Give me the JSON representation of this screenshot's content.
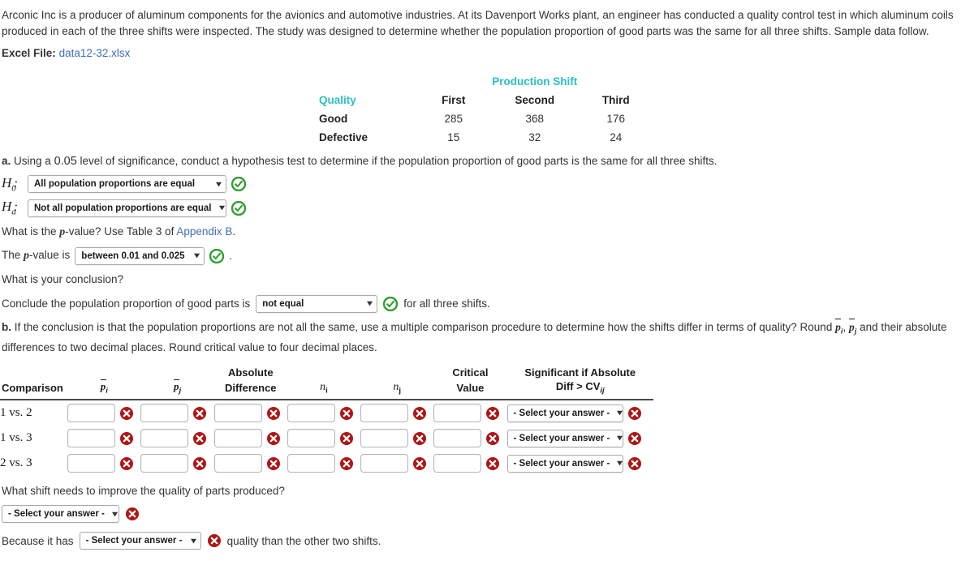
{
  "intro": {
    "paragraph": "Arconic Inc is a producer of aluminum components for the avionics and automotive industries. At its Davenport Works plant, an engineer has conducted a quality control test in which aluminum coils produced in each of the three shifts were inspected. The study was designed to determine whether the population proportion of good parts was the same for all three shifts. Sample data follow.",
    "excel_label": "Excel File:",
    "excel_file": "data12-32.xlsx"
  },
  "data_table": {
    "group_header": "Production Shift",
    "row_header": "Quality",
    "columns": [
      "First",
      "Second",
      "Third"
    ],
    "rows": [
      {
        "label": "Good",
        "values": [
          "285",
          "368",
          "176"
        ]
      },
      {
        "label": "Defective",
        "values": [
          "15",
          "32",
          "24"
        ]
      }
    ]
  },
  "part_a": {
    "prompt_pre": "Using a ",
    "significance": "0.05",
    "prompt_post": " level of significance, conduct a hypothesis test to determine if the population proportion of good parts is the same for all three shifts.",
    "letter": "a.",
    "h0_label": "H",
    "h0_sub": "0",
    "h0_value": "All population proportions are equal",
    "ha_label": "H",
    "ha_sub": "a",
    "ha_value": "Not all population proportions are equal",
    "pvalue_question_pre": "What is the ",
    "pvalue_question_mid": "-value? Use Table 3 of ",
    "appendix_link": "Appendix B",
    "pvalue_question_end": ".",
    "pvalue_prefix": "The ",
    "pvalue_suffix": "-value is",
    "pvalue_value": "between 0.01 and 0.025",
    "pvalue_period": ".",
    "conclusion_question": "What is your conclusion?",
    "conclusion_prefix": "Conclude the population proportion of good parts is",
    "conclusion_value": "not equal",
    "conclusion_suffix": "for all three shifts."
  },
  "part_b": {
    "letter": "b.",
    "text_1": "If the conclusion is that the population proportions are not all the same, use a multiple comparison procedure to determine how the shifts differ in terms of quality? Round ",
    "p_i": "p",
    "p_j": "p",
    "sub_i": "i",
    "sub_j": "j",
    "text_2": " and their absolute differences to two decimal places. Round critical value to four decimal places.",
    "comma": ", ",
    "headers": {
      "comparison": "Comparison",
      "pi": "p",
      "pj": "p",
      "abs_top": "Absolute",
      "abs_bottom": "Difference",
      "ni": "n",
      "nj": "n",
      "crit_top": "Critical",
      "crit_bottom": "Value",
      "sig_top": "Significant if Absolute",
      "sig_bottom_pre": "Diff > CV",
      "sig_bottom_sub": "ij"
    },
    "rows": [
      {
        "label": "1 vs. 2",
        "pi": "",
        "pj": "",
        "abs_diff": "",
        "ni": "",
        "nj": "",
        "crit": "",
        "select": "- Select your answer -"
      },
      {
        "label": "1 vs. 3",
        "pi": "",
        "pj": "",
        "abs_diff": "",
        "ni": "",
        "nj": "",
        "crit": "",
        "select": "- Select your answer -"
      },
      {
        "label": "2 vs. 3",
        "pi": "",
        "pj": "",
        "abs_diff": "",
        "ni": "",
        "nj": "",
        "crit": "",
        "select": "- Select your answer -"
      }
    ]
  },
  "bottom": {
    "question": "What shift needs to improve the quality of parts produced?",
    "shift_select": "- Select your answer -",
    "because_prefix": "Because it has",
    "quality_select": "- Select your answer -",
    "because_suffix": "quality than the other two shifts."
  },
  "icons": {
    "correct": "green-check-circle-icon",
    "incorrect": "red-x-circle-icon",
    "caret": "chevron-down-icon"
  },
  "colors": {
    "teal": "#2bbfc4",
    "link": "#3e6fb8",
    "green": "#2f9e2f",
    "red": "#b01515"
  }
}
